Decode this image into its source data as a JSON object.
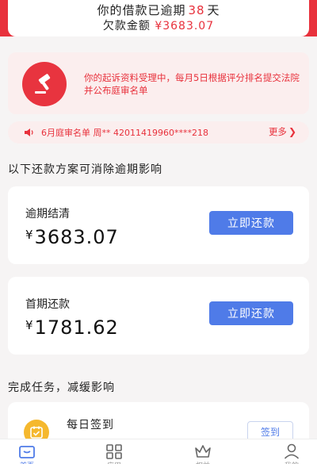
{
  "header": {
    "overdue_prefix": "你的借款已逾期",
    "overdue_days": "38",
    "overdue_suffix": "天",
    "debt_label": "欠款金额",
    "debt_amount": "¥3683.07"
  },
  "notice": {
    "text": "你的起诉资料受理中，每月5日根据评分排名提交法院并公布庭审名单",
    "icon": "gavel-icon"
  },
  "ticker": {
    "icon": "speaker-icon",
    "text": "6月庭审名单  周**  42011419960****218",
    "more_label": "更多",
    "more_icon": "chevron-right-icon"
  },
  "plans_section": {
    "title": "以下还款方案可消除逾期影响",
    "plans": [
      {
        "label": "逾期结清",
        "currency": "¥",
        "amount": "3683.07",
        "button_label": "立即还款"
      },
      {
        "label": "首期还款",
        "currency": "¥",
        "amount": "1781.62",
        "button_label": "立即还款"
      }
    ]
  },
  "tasks_section": {
    "title": "完成任务，减缓影响",
    "tasks": [
      {
        "title": "每日签到",
        "icon": "calendar-check-icon",
        "button_label": "签到"
      }
    ]
  },
  "bottom_nav": {
    "items": [
      {
        "label": "首页",
        "icon": "home-icon"
      },
      {
        "label": "应用",
        "icon": "grid-icon"
      },
      {
        "label": "权益",
        "icon": "crown-icon"
      },
      {
        "label": "我的",
        "icon": "user-icon"
      }
    ]
  },
  "colors": {
    "brand_red": "#e8313c",
    "accent_blue": "#4f7be8",
    "notice_bg": "#fbeeee",
    "task_yellow": "#f5b82e"
  }
}
